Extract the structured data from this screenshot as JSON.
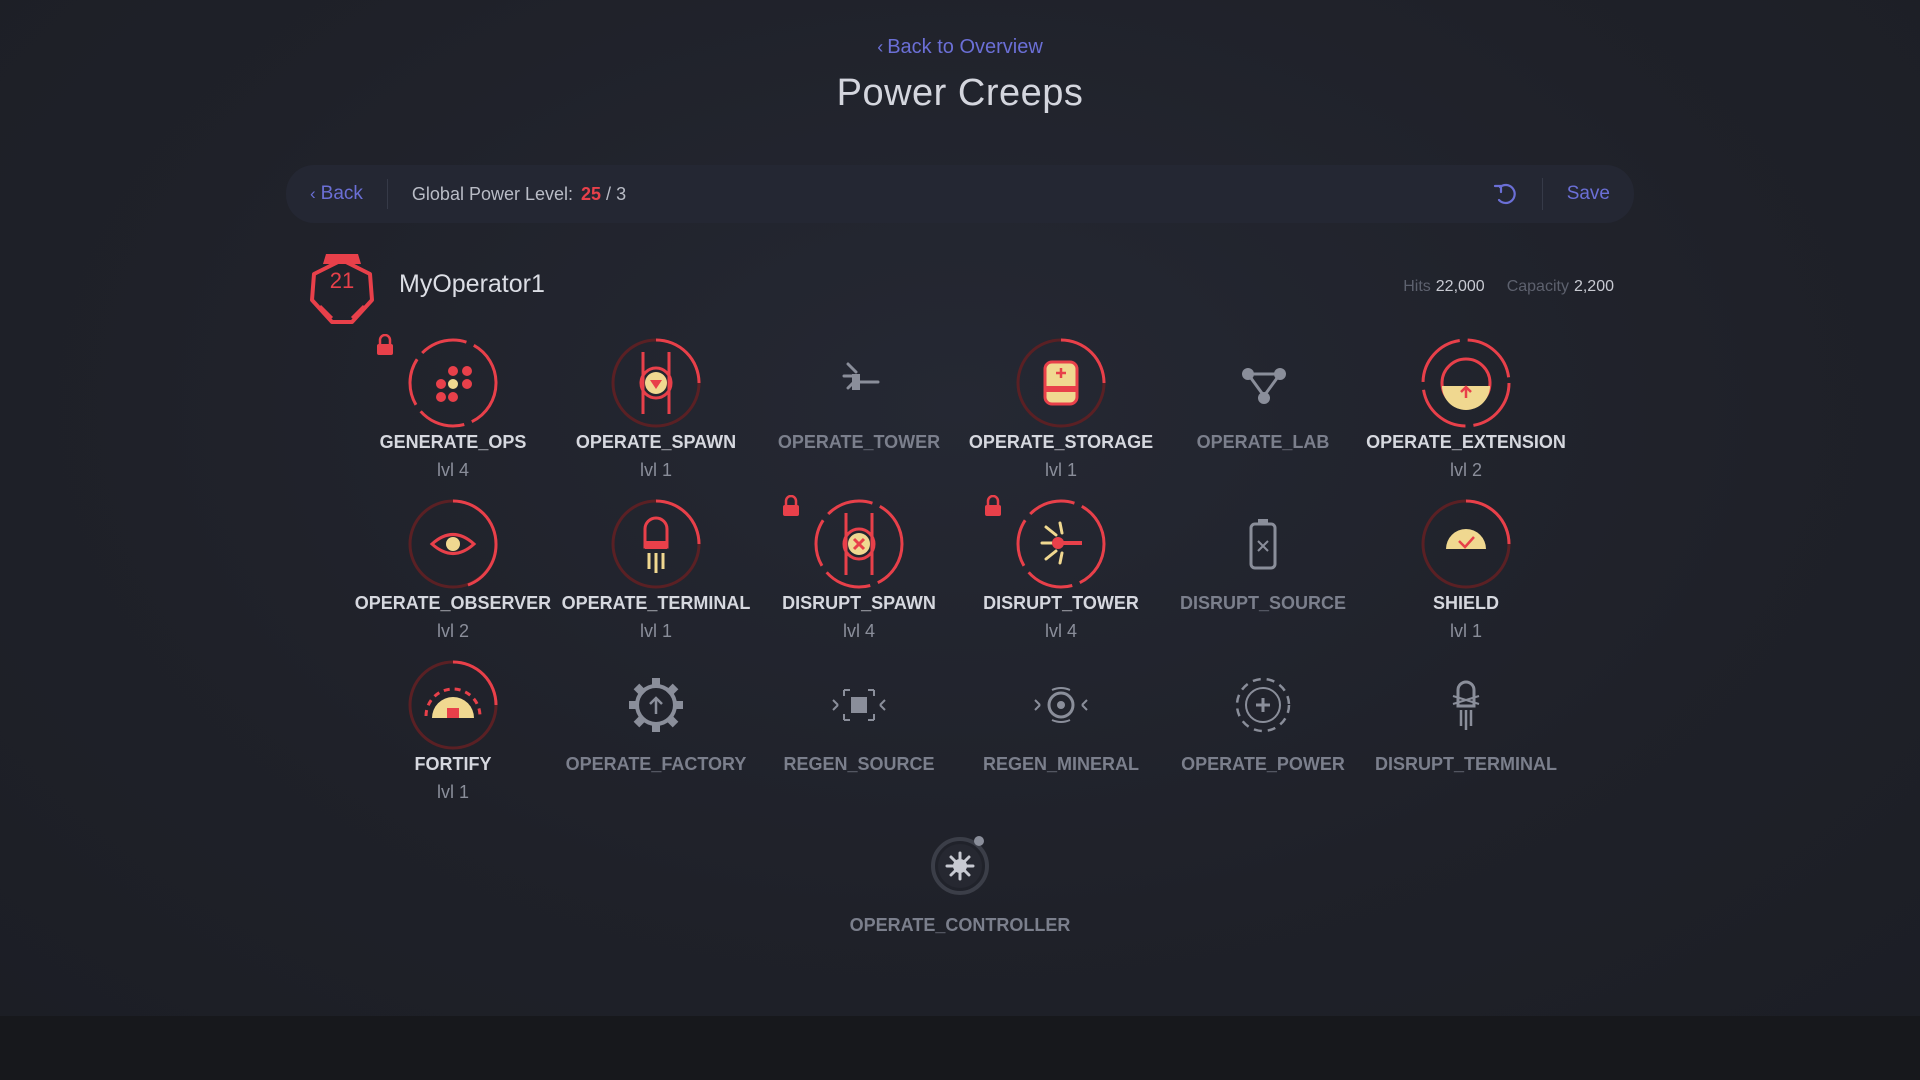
{
  "nav": {
    "back_to_overview": "Back to Overview",
    "title": "Power Creeps"
  },
  "toolbar": {
    "back_label": "Back",
    "global_label": "Global Power Level:",
    "global_current": "25",
    "global_sep": "/",
    "global_max": "3",
    "save_label": "Save"
  },
  "creep": {
    "level": "21",
    "name": "MyOperator1",
    "hits_label": "Hits",
    "hits_value": "22,000",
    "capacity_label": "Capacity",
    "capacity_value": "2,200"
  },
  "colors": {
    "accent": "#e8404a",
    "link": "#6b6fd6",
    "gold": "#f0d890",
    "inactive": "#7b7f8c"
  },
  "powers": [
    {
      "name": "GENERATE_OPS",
      "level": "lvl 4",
      "active": true,
      "locked": true,
      "icon": "ops-dots-icon"
    },
    {
      "name": "OPERATE_SPAWN",
      "level": "lvl 1",
      "active": true,
      "locked": false,
      "icon": "spawn-icon"
    },
    {
      "name": "OPERATE_TOWER",
      "level": "",
      "active": false,
      "locked": false,
      "icon": "tower-icon"
    },
    {
      "name": "OPERATE_STORAGE",
      "level": "lvl 1",
      "active": true,
      "locked": false,
      "icon": "storage-icon"
    },
    {
      "name": "OPERATE_LAB",
      "level": "",
      "active": false,
      "locked": false,
      "icon": "lab-icon"
    },
    {
      "name": "OPERATE_EXTENSION",
      "level": "lvl 2",
      "active": true,
      "locked": false,
      "icon": "extension-icon"
    },
    {
      "name": "OPERATE_OBSERVER",
      "level": "lvl 2",
      "active": true,
      "locked": false,
      "icon": "eye-icon"
    },
    {
      "name": "OPERATE_TERMINAL",
      "level": "lvl 1",
      "active": true,
      "locked": false,
      "icon": "terminal-icon"
    },
    {
      "name": "DISRUPT_SPAWN",
      "level": "lvl 4",
      "active": true,
      "locked": true,
      "icon": "disrupt-spawn-icon"
    },
    {
      "name": "DISRUPT_TOWER",
      "level": "lvl 4",
      "active": true,
      "locked": true,
      "icon": "disrupt-tower-icon"
    },
    {
      "name": "DISRUPT_SOURCE",
      "level": "",
      "active": false,
      "locked": false,
      "icon": "battery-icon"
    },
    {
      "name": "SHIELD",
      "level": "lvl 1",
      "active": true,
      "locked": false,
      "icon": "shield-icon"
    },
    {
      "name": "FORTIFY",
      "level": "lvl 1",
      "active": true,
      "locked": false,
      "icon": "fortify-icon"
    },
    {
      "name": "OPERATE_FACTORY",
      "level": "",
      "active": false,
      "locked": false,
      "icon": "factory-gear-icon"
    },
    {
      "name": "REGEN_SOURCE",
      "level": "",
      "active": false,
      "locked": false,
      "icon": "regen-source-icon"
    },
    {
      "name": "REGEN_MINERAL",
      "level": "",
      "active": false,
      "locked": false,
      "icon": "regen-mineral-icon"
    },
    {
      "name": "OPERATE_POWER",
      "level": "",
      "active": false,
      "locked": false,
      "icon": "operate-power-icon"
    },
    {
      "name": "DISRUPT_TERMINAL",
      "level": "",
      "active": false,
      "locked": false,
      "icon": "disrupt-terminal-icon"
    },
    {
      "name": "OPERATE_CONTROLLER",
      "level": "",
      "active": false,
      "locked": false,
      "icon": "controller-icon"
    }
  ]
}
